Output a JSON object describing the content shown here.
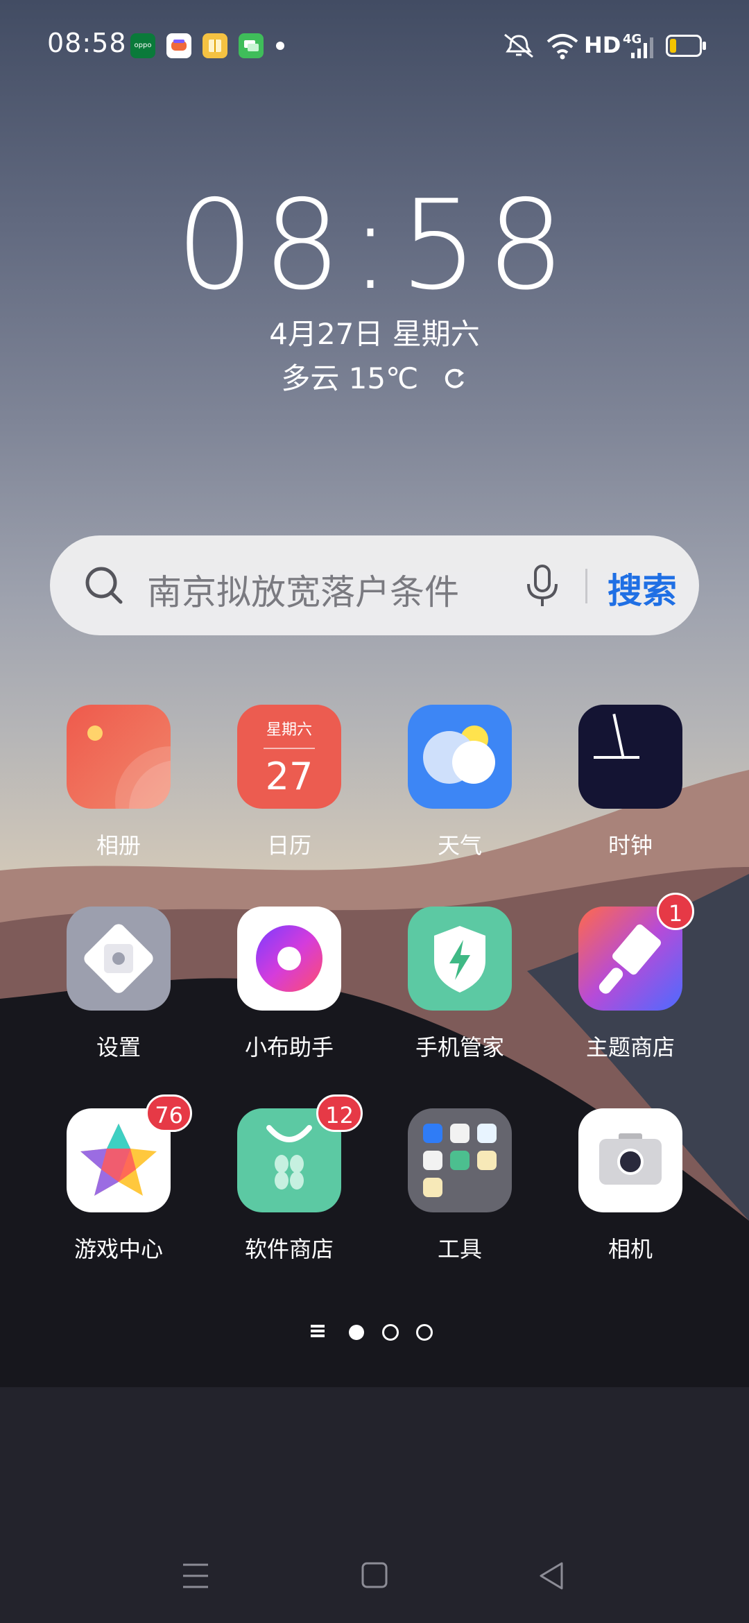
{
  "status_bar": {
    "time": "08:58",
    "network": "HD",
    "signal": "4G",
    "notification_icons": [
      "oppo-app-icon",
      "game-app-icon",
      "reader-app-icon",
      "message-app-icon"
    ],
    "battery_level": 0.2
  },
  "clock_widget": {
    "time": "08:58",
    "date": "4月27日 星期六",
    "weather": "多云 15℃"
  },
  "search": {
    "placeholder": "南京拟放宽落户条件",
    "button": "搜索"
  },
  "apps": [
    {
      "label": "相册",
      "icon": "gallery-icon"
    },
    {
      "label": "日历",
      "icon": "calendar-icon",
      "weekday": "星期六",
      "day": "27"
    },
    {
      "label": "天气",
      "icon": "weather-icon"
    },
    {
      "label": "时钟",
      "icon": "clock-icon"
    },
    {
      "label": "设置",
      "icon": "settings-icon"
    },
    {
      "label": "小布助手",
      "icon": "assistant-icon"
    },
    {
      "label": "手机管家",
      "icon": "phone-manager-icon"
    },
    {
      "label": "主题商店",
      "icon": "theme-store-icon",
      "badge": "1"
    },
    {
      "label": "游戏中心",
      "icon": "game-center-icon",
      "badge": "76"
    },
    {
      "label": "软件商店",
      "icon": "app-store-icon",
      "badge": "12"
    },
    {
      "label": "工具",
      "icon": "tools-folder-icon"
    },
    {
      "label": "相机",
      "icon": "camera-icon"
    }
  ],
  "page_indicator": {
    "pages": 3,
    "current": 1
  },
  "colors": {
    "search_accent": "#1f6fe4",
    "badge": "#e63946"
  }
}
